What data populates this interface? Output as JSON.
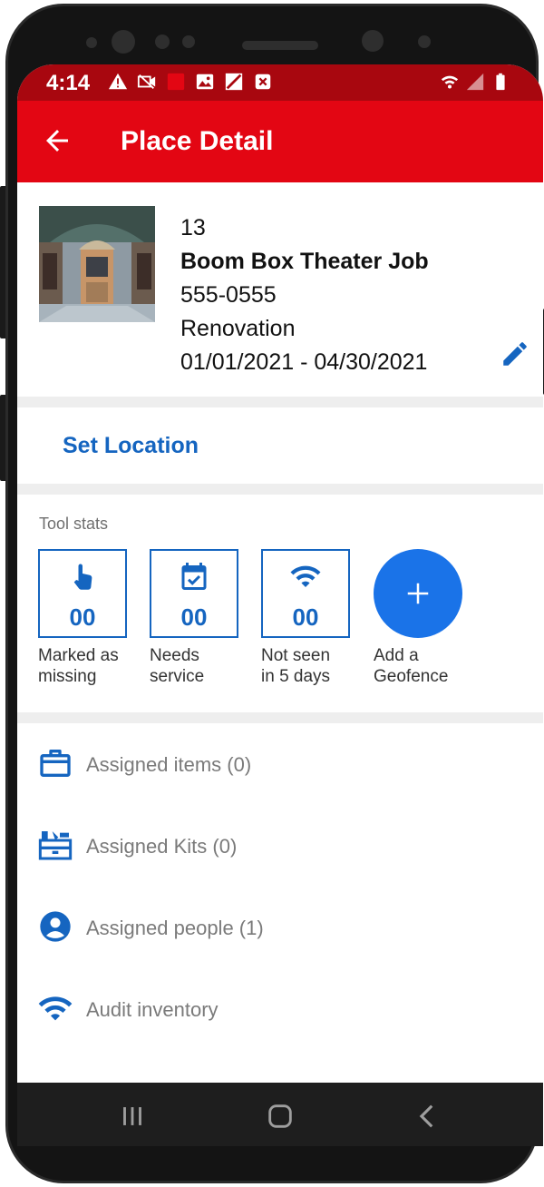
{
  "status_bar": {
    "time": "4:14",
    "icons": [
      "warning-icon",
      "camera-off-icon",
      "app-red-icon",
      "image-icon",
      "no-signal-icon",
      "close-box-icon"
    ],
    "right_icons": [
      "wifi-icon",
      "signal-icon",
      "battery-icon"
    ]
  },
  "app_bar": {
    "title": "Place Detail",
    "back_icon": "arrow-left-icon",
    "color": "#e30613"
  },
  "place": {
    "number": "13",
    "name": "Boom Box Theater Job",
    "phone": "555-0555",
    "type": "Renovation",
    "dates": "01/01/2021 - 04/30/2021"
  },
  "set_location": {
    "label": "Set Location"
  },
  "tool_stats": {
    "title": "Tool stats",
    "items": [
      {
        "icon": "touch-icon",
        "value": "00",
        "label_line1": "Marked as",
        "label_line2": "missing"
      },
      {
        "icon": "calendar-check-icon",
        "value": "00",
        "label_line1": "Needs",
        "label_line2": "service"
      },
      {
        "icon": "wifi-icon",
        "value": "00",
        "label_line1": "Not seen",
        "label_line2": "in 5 days"
      }
    ],
    "add": {
      "icon": "plus-icon",
      "label_line1": "Add a",
      "label_line2": "Geofence"
    }
  },
  "menu": {
    "items": [
      {
        "icon": "briefcase-icon",
        "label": "Assigned items (0)"
      },
      {
        "icon": "toolbox-icon",
        "label": "Assigned Kits (0)"
      },
      {
        "icon": "person-circle-icon",
        "label": "Assigned people (1)"
      },
      {
        "icon": "wifi-icon",
        "label": "Audit inventory"
      }
    ]
  },
  "colors": {
    "primary_blue": "#1565c0",
    "fab_blue": "#1a73e8",
    "status_red": "#a8070f"
  }
}
